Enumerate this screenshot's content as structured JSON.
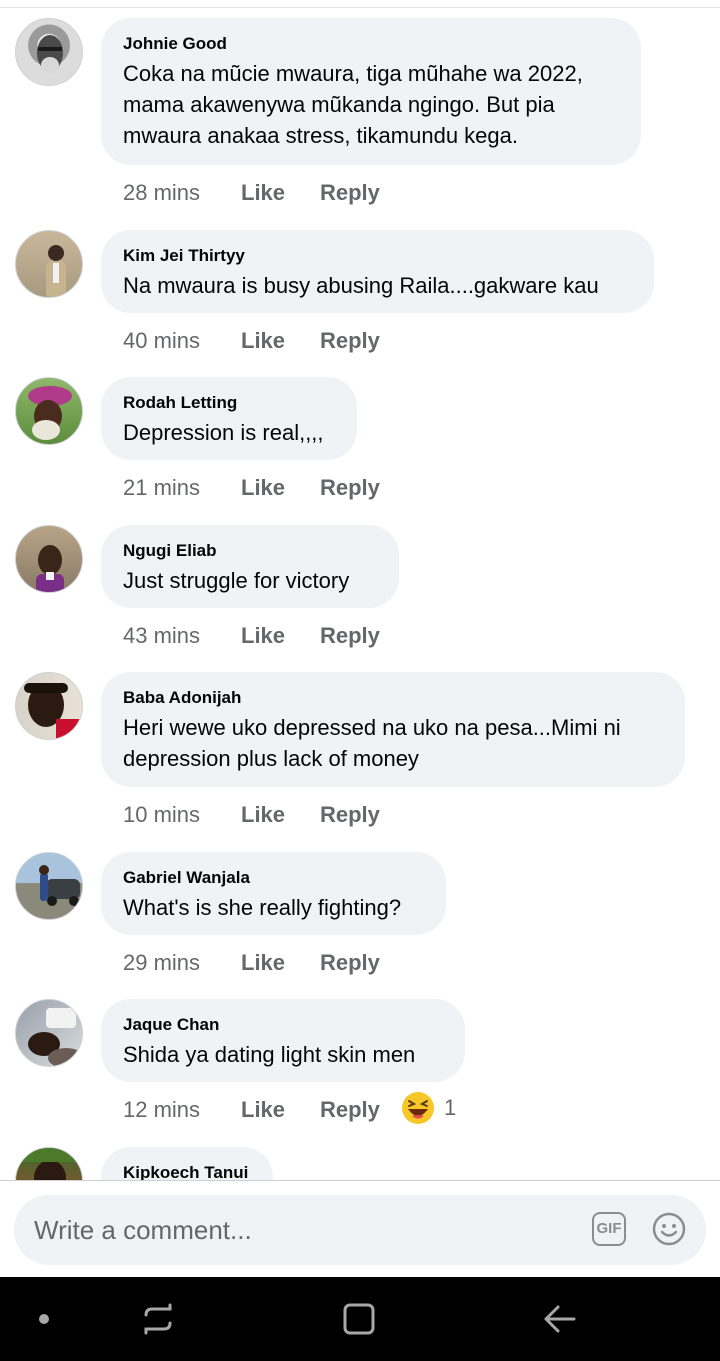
{
  "comments": [
    {
      "author": "Johnie Good",
      "text": "Coka na mũcie mwaura, tiga mũhahe wa 2022, mama akawenywa mũkanda ngingo. But pia mwaura anakaa stress, tikamundu kega.",
      "time": "28 mins",
      "like": "Like",
      "reply": "Reply"
    },
    {
      "author": "Kim Jei Thirtyy",
      "text": "Na mwaura is busy abusing Raila....gakware kau",
      "time": "40 mins",
      "like": "Like",
      "reply": "Reply"
    },
    {
      "author": "Rodah Letting",
      "text": "Depression is real,,,,",
      "time": "21 mins",
      "like": "Like",
      "reply": "Reply"
    },
    {
      "author": "Ngugi Eliab",
      "text": "Just struggle for victory",
      "time": "43 mins",
      "like": "Like",
      "reply": "Reply"
    },
    {
      "author": "Baba Adonijah",
      "text": "Heri wewe uko depressed na uko na pesa...Mimi ni depression plus lack of money",
      "time": "10 mins",
      "like": "Like",
      "reply": "Reply"
    },
    {
      "author": "Gabriel Wanjala",
      "text": "What's is she really fighting?",
      "time": "29 mins",
      "like": "Like",
      "reply": "Reply"
    },
    {
      "author": "Jaque Chan",
      "text": "Shida ya dating light skin men",
      "time": "12 mins",
      "like": "Like",
      "reply": "Reply",
      "reaction": {
        "icon": "laughing-emoji",
        "count": "1"
      }
    },
    {
      "author": "Kipkoech Tanui"
    }
  ],
  "composer": {
    "placeholder": "Write a comment...",
    "gif_label": "GIF",
    "emoji_icon": "smiley-icon"
  },
  "navbar": {
    "icons": [
      "dot-icon",
      "recent-apps-icon",
      "home-icon",
      "back-icon"
    ]
  },
  "colors": {
    "bubble": "#f0f2f5",
    "meta_text": "#65676b",
    "navbar": "#000000"
  }
}
